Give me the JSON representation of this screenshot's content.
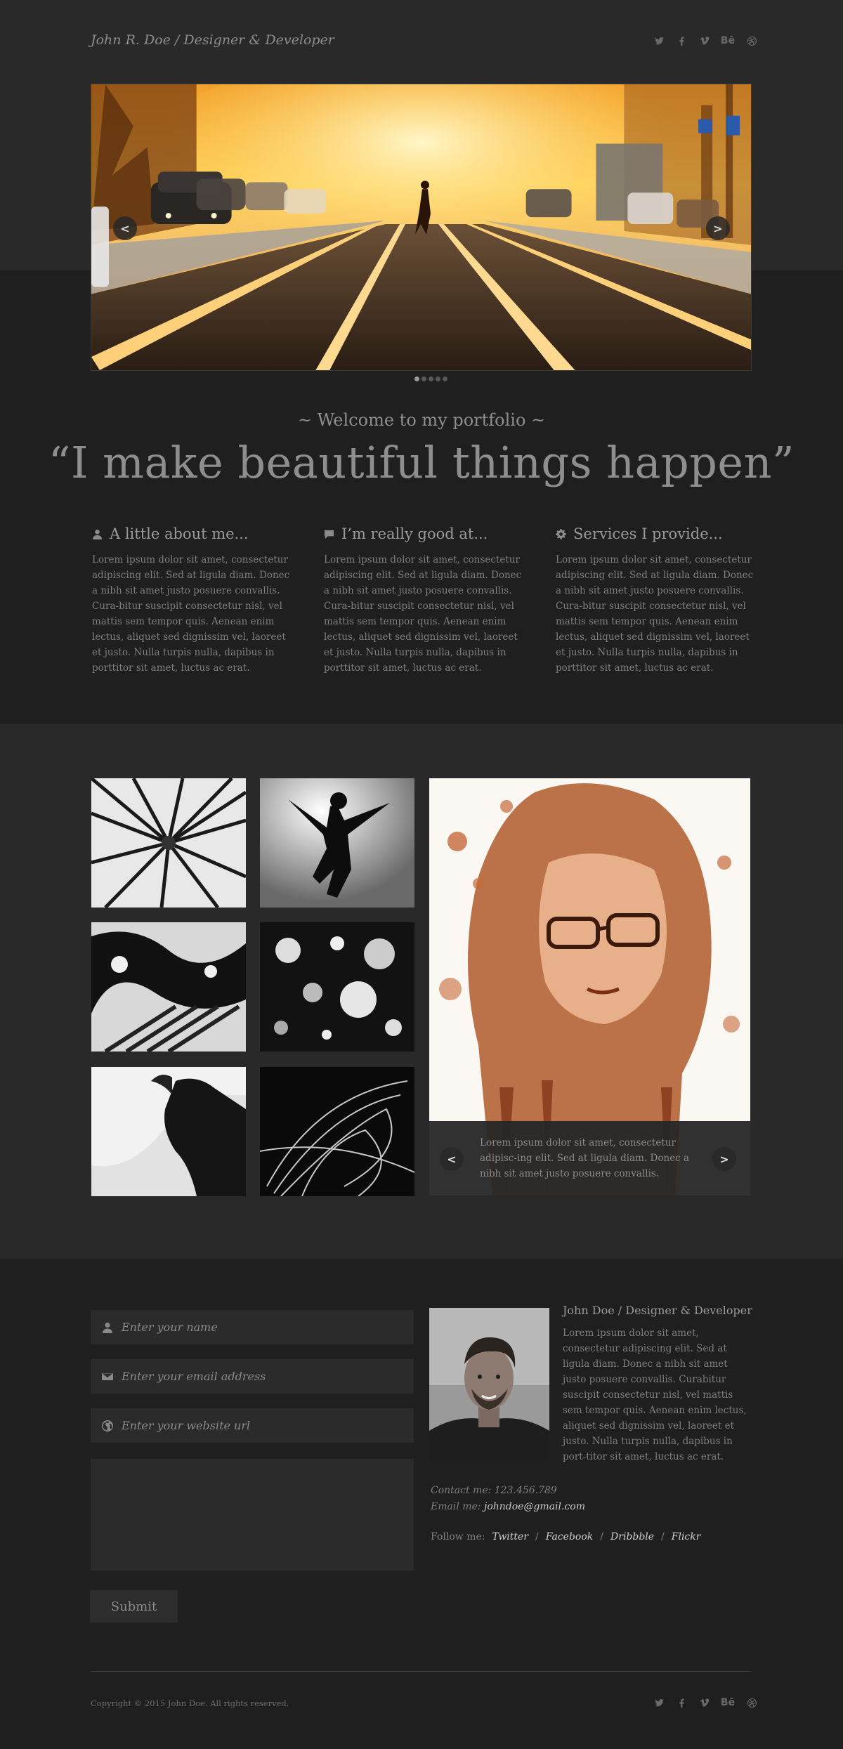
{
  "header": {
    "title": "John R. Doe / Designer & Developer",
    "social": [
      "twitter-icon",
      "facebook-icon",
      "vimeo-icon",
      "behance-icon",
      "dribbble-icon"
    ]
  },
  "slider": {
    "prev_label": "<",
    "next_label": ">",
    "dots_total": 5,
    "dots_active": 0
  },
  "intro": {
    "welcome": "~ Welcome to my portfolio ~",
    "tagline": "“I make beautiful things happen”"
  },
  "columns": [
    {
      "icon": "user-icon",
      "title": "A little about me...",
      "text": "Lorem ipsum dolor sit amet, consectetur adipiscing elit. Sed at ligula diam. Donec a nibh sit amet justo posuere convallis. Cura-bitur suscipit consectetur nisl, vel mattis sem tempor quis. Aenean enim lectus, aliquet sed dignissim vel, laoreet et justo. Nulla turpis nulla, dapibus in porttitor sit amet, luctus ac erat."
    },
    {
      "icon": "speech-bubble-icon",
      "title": "I’m really good at...",
      "text": "Lorem ipsum dolor sit amet, consectetur adipiscing elit. Sed at ligula diam. Donec a nibh sit amet justo posuere convallis. Cura-bitur suscipit consectetur nisl, vel mattis sem tempor quis. Aenean enim lectus, aliquet sed dignissim vel, laoreet et justo. Nulla turpis nulla, dapibus in porttitor sit amet, luctus ac erat."
    },
    {
      "icon": "gear-icon",
      "title": "Services I provide...",
      "text": "Lorem ipsum dolor sit amet, consectetur adipiscing elit. Sed at ligula diam. Donec a nibh sit amet justo posuere convallis. Cura-bitur suscipit consectetur nisl, vel mattis sem tempor quis. Aenean enim lectus, aliquet sed dignissim vel, laoreet et justo. Nulla turpis nulla, dapibus in porttitor sit amet, luctus ac erat."
    }
  ],
  "gallery": {
    "caption": "Lorem ipsum dolor sit amet, consectetur adipisc-ing elit. Sed at ligula diam. Donec a nibh sit amet justo posuere convallis.",
    "prev_label": "<",
    "next_label": ">"
  },
  "contact_form": {
    "name_placeholder": "Enter your name",
    "email_placeholder": "Enter your email address",
    "website_placeholder": "Enter your website url",
    "submit_label": "Submit"
  },
  "profile": {
    "title": "John Doe / Designer & Developer",
    "bio": "Lorem ipsum dolor sit amet, consectetur adipiscing elit. Sed at ligula diam. Donec a nibh sit amet justo posuere convallis. Curabitur suscipit consectetur nisl, vel mattis sem tempor quis. Aenean enim lectus, aliquet sed dignissim vel, laoreet et justo. Nulla turpis nulla, dapibus in port-titor sit amet, luctus ac erat.",
    "contact_label": "Contact me: 123.456.789",
    "email_label": "Email me:",
    "email_value": "johndoe@gmail.com",
    "follow_label": "Follow me:",
    "links": [
      "Twitter",
      "Facebook",
      "Dribbble",
      "Flickr"
    ]
  },
  "footer": {
    "copyright": "Copyright © 2015 John Doe. All rights reserved."
  }
}
